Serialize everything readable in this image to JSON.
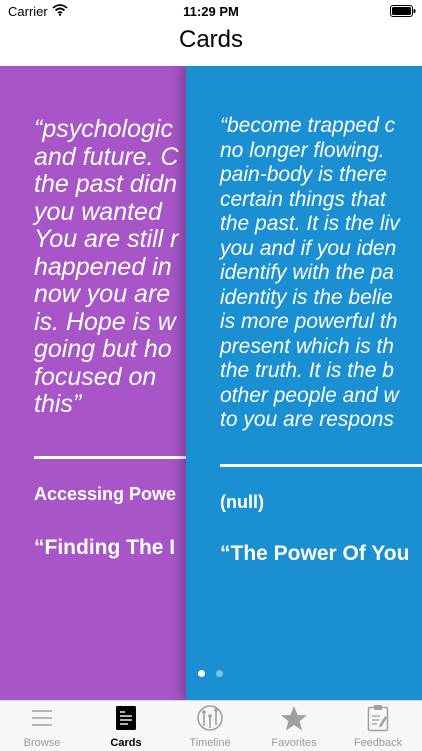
{
  "status_bar": {
    "carrier": "Carrier",
    "time": "11:29 PM"
  },
  "nav": {
    "title": "Cards"
  },
  "cards": [
    {
      "color": "#a855c7",
      "quote_lines": [
        "“psychologic",
        "and future. C",
        "the past didn",
        "you wanted",
        "You are still r",
        "happened in",
        "now you are",
        "is. Hope is w",
        "going but ho",
        "focused on",
        "this”"
      ],
      "meta": "Accessing Powe",
      "title": "“Finding The I"
    },
    {
      "color": "#1a8fd1",
      "quote_lines": [
        "“become trapped c",
        "no longer flowing.",
        "pain-body is there",
        "certain things that",
        "the past. It is the liv",
        "you and if you iden",
        "identify with the pa",
        "identity is the belie",
        "is more powerful th",
        "present which is th",
        "the truth. It is the b",
        "other people and w",
        "to you are respons"
      ],
      "meta": "(null)",
      "title": "“The Power Of You"
    }
  ],
  "tabs": [
    {
      "label": "Browse",
      "icon": "list-icon",
      "active": false
    },
    {
      "label": "Cards",
      "icon": "card-icon",
      "active": true
    },
    {
      "label": "Timeline",
      "icon": "timeline-icon",
      "active": false
    },
    {
      "label": "Favorites",
      "icon": "star-icon",
      "active": false
    },
    {
      "label": "Feedback",
      "icon": "clipboard-icon",
      "active": false
    }
  ]
}
